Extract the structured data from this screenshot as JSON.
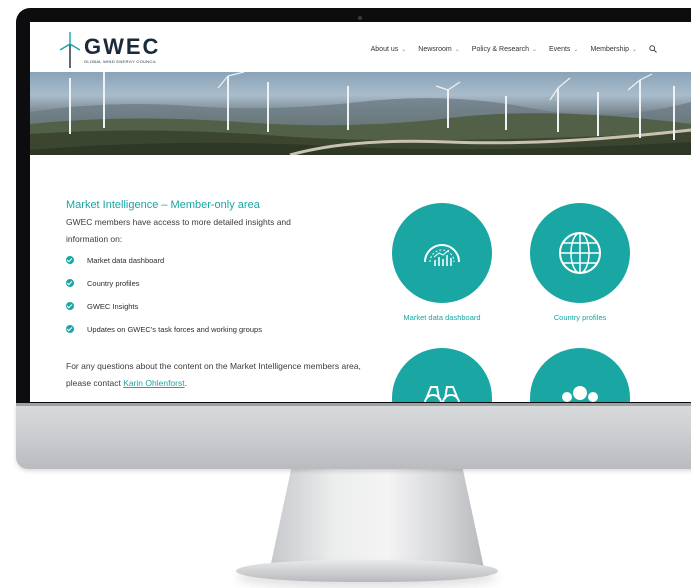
{
  "brand": {
    "name": "GWEC",
    "tagline": "GLOBAL WIND ENERGY COUNCIL"
  },
  "nav": {
    "items": [
      {
        "label": "About us"
      },
      {
        "label": "Newsroom"
      },
      {
        "label": "Policy & Research"
      },
      {
        "label": "Events"
      },
      {
        "label": "Membership"
      }
    ]
  },
  "content": {
    "section_title": "Market Intelligence – Member-only area",
    "intro": "GWEC members have access to more detailed insights and information on:",
    "features": [
      "Market data dashboard",
      "Country profiles",
      "GWEC Insights",
      "Updates on GWEC’s task forces and working groups"
    ],
    "contact_text": "For any questions about the content on the Market Intelligence members area, please contact ",
    "contact_link": "Karin Ohlenforst",
    "contact_end": "."
  },
  "tiles": [
    {
      "caption": "Market data dashboard",
      "icon": "dashboard-gauge-icon"
    },
    {
      "caption": "Country profiles",
      "icon": "globe-icon"
    },
    {
      "caption": "",
      "icon": "binoculars-icon"
    },
    {
      "caption": "",
      "icon": "people-group-icon"
    }
  ],
  "colors": {
    "accent": "#1aa6a3",
    "bezel": "#0d0d0f",
    "text": "#3b3b3b"
  }
}
